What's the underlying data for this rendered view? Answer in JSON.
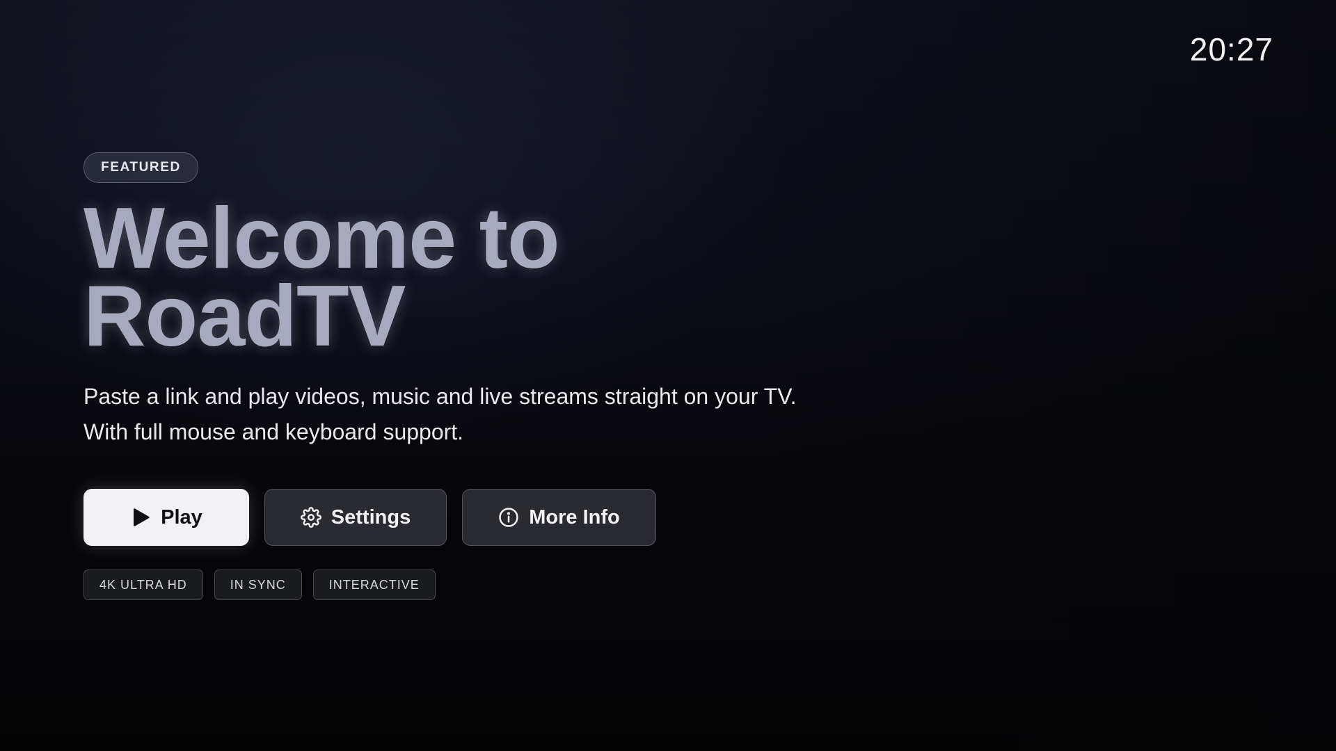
{
  "status": {
    "clock": "20:27"
  },
  "hero": {
    "badge": "FEATURED",
    "title_line1": "Welcome to",
    "title_line2": "RoadTV",
    "description_line1": "Paste a link and play videos, music and live streams straight on your TV.",
    "description_line2": "With full mouse and keyboard support."
  },
  "actions": {
    "play": {
      "label": "Play",
      "icon": "play-icon"
    },
    "settings": {
      "label": "Settings",
      "icon": "gear-icon"
    },
    "more_info": {
      "label": "More Info",
      "icon": "info-icon"
    }
  },
  "tags": [
    "4K ULTRA HD",
    "IN SYNC",
    "INTERACTIVE"
  ],
  "colors": {
    "title": "#a7a9bf",
    "primary_button": "#f1f1f3",
    "secondary_button": "#303138",
    "background": "#0c0d16"
  }
}
